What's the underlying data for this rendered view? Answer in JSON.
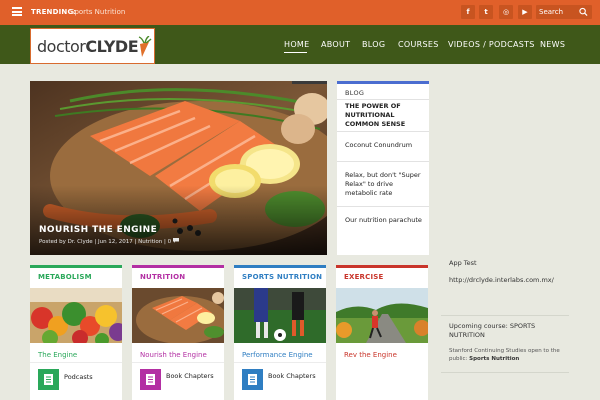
{
  "topbar": {
    "trending_label": "TRENDING:",
    "trending_topic": "Sports Nutrition",
    "social": [
      {
        "icon": "facebook-icon",
        "glyph": "f"
      },
      {
        "icon": "twitter-icon",
        "glyph": "t"
      },
      {
        "icon": "instagram-icon",
        "glyph": "◎"
      },
      {
        "icon": "youtube-icon",
        "glyph": "▶"
      }
    ],
    "search_placeholder": "Search"
  },
  "logo": {
    "prefix": "doctor",
    "name": "CLYDE"
  },
  "nav": {
    "items": [
      "HOME",
      "ABOUT",
      "BLOG",
      "COURSES",
      "VIDEOS / PODCASTS",
      "NEWS"
    ],
    "active": "HOME"
  },
  "hero": {
    "title": "NOURISH THE ENGINE",
    "meta": "Posted by Dr. Clyde | Jun 12, 2017 | Nutrition | 0"
  },
  "blog_widget": {
    "heading": "BLOG",
    "items": [
      "THE POWER OF NUTRITIONAL COMMON SENSE",
      "Coconut Conundrum",
      "Relax, but don't \"Super Relax\" to drive metabolic rate",
      "Our nutrition parachute"
    ]
  },
  "sidebar": {
    "app_test_title": "App Test",
    "app_test_url": "http://drclyde.interlabs.com.mx/",
    "upcoming_title": "Upcoming course: SPORTS NUTRITION",
    "upcoming_text": "Stanford Continuing Studies open to the public:",
    "upcoming_link": "Sports Nutrition"
  },
  "categories": [
    {
      "title": "METABOLISM",
      "subtitle": "The Engine",
      "link": "Podcasts",
      "color": "#2aa85a",
      "icon": "podcast-icon"
    },
    {
      "title": "NUTRITION",
      "subtitle": "Nourish the Engine",
      "link": "Book Chapters",
      "color": "#b32fa3",
      "icon": "book-icon"
    },
    {
      "title": "SPORTS NUTRITION",
      "subtitle": "Performance Engine",
      "link": "Book Chapters",
      "color": "#2f7ec2",
      "icon": "book-icon"
    },
    {
      "title": "EXERCISE",
      "subtitle": "Rev the Engine",
      "link": "",
      "color": "#c9352b",
      "icon": ""
    }
  ],
  "colors": {
    "topbar": "#e0602a",
    "header": "#3f5819",
    "background": "#e8e9e0",
    "blog_accent": "#4b6dd0"
  }
}
